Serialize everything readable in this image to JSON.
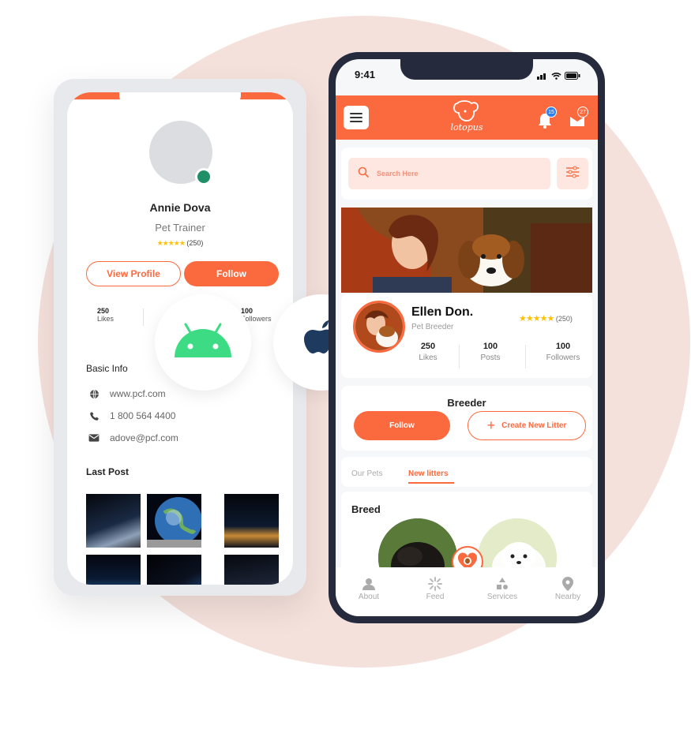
{
  "android": {
    "name": "Annie Dova",
    "role": "Pet Trainer",
    "stars": "★★★★★",
    "rating": "(250)",
    "view_profile": "View Profile",
    "follow": "Follow",
    "stats": [
      {
        "value": "250",
        "label": "Likes"
      },
      {
        "value": "100",
        "label": "Followers"
      }
    ],
    "basic_info_title": "Basic Info",
    "website": "www.pcf.com",
    "phone": "1 800 564 4400",
    "email": "adove@pcf.com",
    "last_post_title": "Last Post"
  },
  "ios": {
    "time": "9:41",
    "logo_text": "lotopus",
    "notifications": "15",
    "messages": "27",
    "search_placeholder": "Search Here",
    "profile": {
      "name": "Ellen Don.",
      "role": "Pet Breeder",
      "stars": "★★★★★",
      "rating": "(250)",
      "stats": [
        {
          "value": "250",
          "label": "Likes"
        },
        {
          "value": "100",
          "label": "Posts"
        },
        {
          "value": "100",
          "label": "Followers"
        }
      ]
    },
    "breeder_title": "Breeder",
    "follow": "Follow",
    "create_litter": "Create New Litter",
    "tabs": [
      "Our Pets",
      "New litters"
    ],
    "breed_title": "Breed",
    "nav": [
      "About",
      "Feed",
      "Services",
      "Nearby"
    ]
  },
  "colors": {
    "accent": "#fb6a3e",
    "blob": "#f5e1dc",
    "phone_frame": "#262a3d",
    "android_green": "#3ddc84",
    "apple": "#1e3a5f"
  }
}
